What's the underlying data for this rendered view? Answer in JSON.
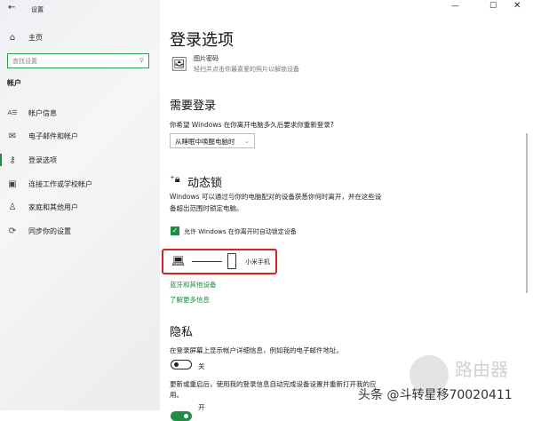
{
  "window": {
    "title": "设置",
    "controls": [
      "minimize",
      "maximize",
      "close"
    ]
  },
  "sidebar": {
    "home": "主页",
    "search_placeholder": "查找设置",
    "section": "帐户",
    "items": [
      {
        "label": "帐户信息",
        "icon": "account-info-icon"
      },
      {
        "label": "电子邮件和帐户",
        "icon": "mail-icon"
      },
      {
        "label": "登录选项",
        "icon": "key-icon",
        "active": true
      },
      {
        "label": "连接工作或学校帐户",
        "icon": "briefcase-icon"
      },
      {
        "label": "家庭和其他用户",
        "icon": "person-icon"
      },
      {
        "label": "同步你的设置",
        "icon": "sync-icon"
      }
    ]
  },
  "main": {
    "title": "登录选项",
    "picture_password": {
      "title": "图片密码",
      "desc": "轻扫并点击你最喜爱的照片以解锁设备"
    },
    "require_signin": {
      "heading": "需要登录",
      "question": "你希望 Windows 在你离开电脑多久后要求你重新登录?",
      "dropdown_value": "从睡眠中唤醒电脑时"
    },
    "dynamic_lock": {
      "heading": "动态锁",
      "desc_line1": "Windows 可以通过与你的电脑配对的设备获悉你何时离开，并在这些设",
      "desc_line2": "备超出范围时锁定电脑。",
      "checkbox_label": "允许 Windows 在你离开时自动锁定设备",
      "checked": true,
      "paired_device": "小米手机",
      "link_bluetooth": "蓝牙和其他设备",
      "link_learn_more": "了解更多信息"
    },
    "privacy": {
      "heading": "隐私",
      "option1": "在登录屏幕上显示帐户详细信息，例如我的电子邮件地址。",
      "option1_state": "关",
      "option1_on": false,
      "option2_line1": "更新或重启后，使用我的登录信息自动完成设备设置并重新打开我的应",
      "option2_line2": "用。",
      "option2_state": "开",
      "option2_on": true
    }
  },
  "watermark": {
    "site": "路由器",
    "credit": "头条 @斗转星移70020411"
  },
  "colors": {
    "accent": "#1e8c45",
    "highlight": "#e02020"
  }
}
